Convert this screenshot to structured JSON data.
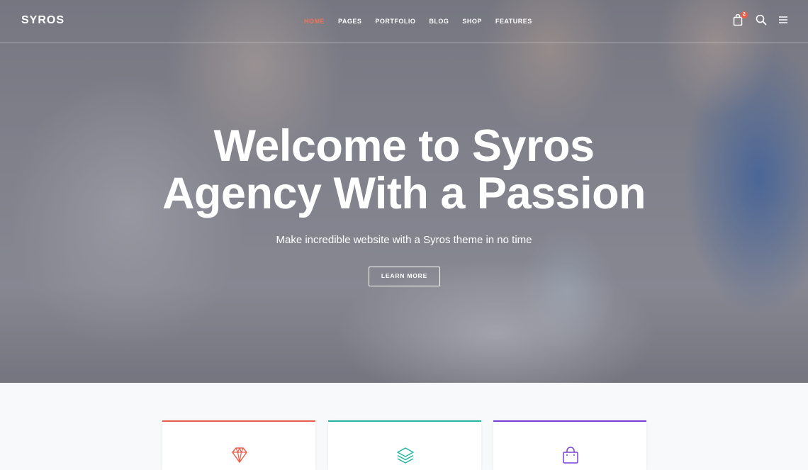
{
  "brand": {
    "logo": "SYROS"
  },
  "nav": {
    "items": [
      {
        "label": "HOME",
        "active": true
      },
      {
        "label": "PAGES",
        "active": false
      },
      {
        "label": "PORTFOLIO",
        "active": false
      },
      {
        "label": "BLOG",
        "active": false
      },
      {
        "label": "SHOP",
        "active": false
      },
      {
        "label": "FEATURES",
        "active": false
      }
    ],
    "cart_count": "2",
    "icons": [
      "shopping-bag-icon",
      "search-icon",
      "menu-icon"
    ]
  },
  "hero": {
    "title_line1": "Welcome to Syros",
    "title_line2": "Agency With a Passion",
    "subtitle": "Make incredible website with a Syros theme in no time",
    "button_label": "LEARN MORE"
  },
  "features": {
    "cards": [
      {
        "icon": "diamond-icon",
        "accent": "#e8604c"
      },
      {
        "icon": "layers-icon",
        "accent": "#26b5a4"
      },
      {
        "icon": "shopping-bag-icon",
        "accent": "#7a3ed8"
      }
    ]
  },
  "colors": {
    "active_nav": "#f0745a",
    "badge": "#e8604c"
  }
}
